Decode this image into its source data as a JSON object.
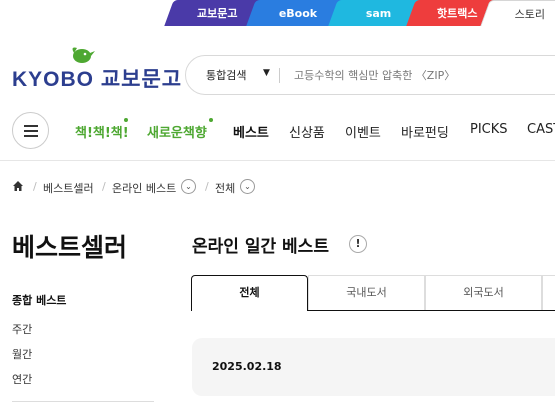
{
  "service_tabs": [
    "교보문고",
    "eBook",
    "sam",
    "핫트랙스",
    "스토리"
  ],
  "logo": {
    "text": "KYOBO 교보문고",
    "brand_color": "#2c3e8f",
    "bird_color": "#4ea832"
  },
  "search": {
    "scope": "통합검색",
    "placeholder": "고등수학의 핵심만 압축한 〈ZIP〉"
  },
  "gnb": {
    "items": [
      "책!책!책!",
      "새로운책향",
      "베스트",
      "신상품",
      "이벤트",
      "바로펀딩",
      "PICKS",
      "CAST"
    ],
    "accent": "#4ea832"
  },
  "breadcrumb": [
    "베스트셀러",
    "온라인 베스트",
    "전체"
  ],
  "side": {
    "title": "베스트셀러",
    "section": "종합 베스트",
    "links": [
      "주간",
      "월간",
      "연간"
    ]
  },
  "main": {
    "title": "온라인 일간 베스트",
    "info_icon": "!",
    "tabs": [
      "전체",
      "국내도서",
      "외국도서"
    ],
    "date": "2025.02.18"
  }
}
